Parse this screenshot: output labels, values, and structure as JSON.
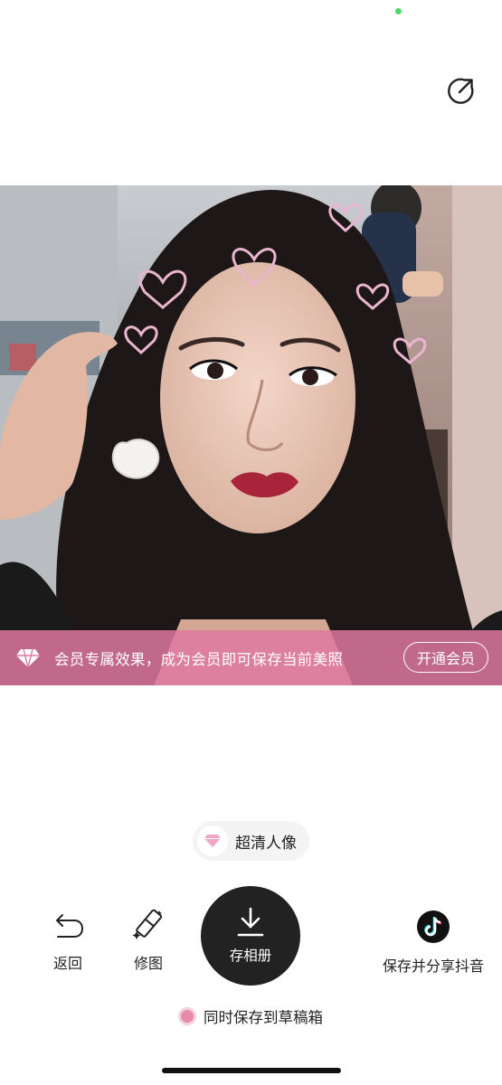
{
  "vip_banner": {
    "icon": "diamond-icon",
    "message": "会员专属效果，成为会员即可保存当前美照",
    "open_button": "开通会员"
  },
  "hd_chip": {
    "icon": "pink-gem-icon",
    "label": "超清人像"
  },
  "actions": {
    "back": {
      "icon": "undo-arrow-icon",
      "label": "返回"
    },
    "edit": {
      "icon": "magic-eraser-icon",
      "label": "修图"
    },
    "save": {
      "icon": "download-icon",
      "label": "存相册"
    },
    "douyin": {
      "icon": "tiktok-icon",
      "label": "保存并分享抖音"
    }
  },
  "draft_option": {
    "label": "同时保存到草稿箱",
    "checked": true
  },
  "colors": {
    "banner": "#de78a0",
    "save_button": "#222222",
    "accent_pink": "#e88aab"
  }
}
